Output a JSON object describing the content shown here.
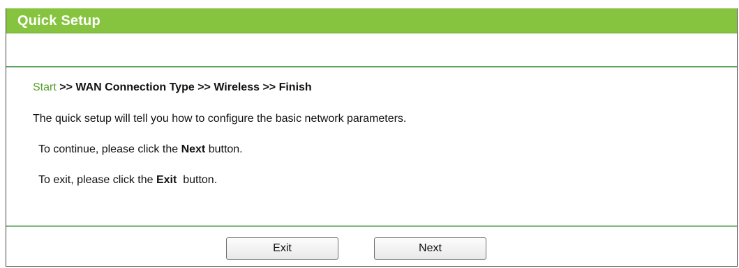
{
  "header": {
    "title": "Quick Setup"
  },
  "steps": {
    "start": "Start",
    "rest": " >> WAN Connection Type >> Wireless >> Finish"
  },
  "content": {
    "description": "The quick setup will tell you how to configure the basic network parameters.",
    "continue_prefix": "To continue, please click the ",
    "continue_bold": "Next",
    "continue_suffix": " button.",
    "exit_prefix": "To exit, please click the ",
    "exit_bold": "Exit",
    "exit_suffix": "  button."
  },
  "buttons": {
    "exit_label": "Exit",
    "next_label": "Next"
  },
  "colors": {
    "header_bg": "#86c440",
    "divider": "#7fbf7f",
    "step_active": "#55a02a"
  }
}
